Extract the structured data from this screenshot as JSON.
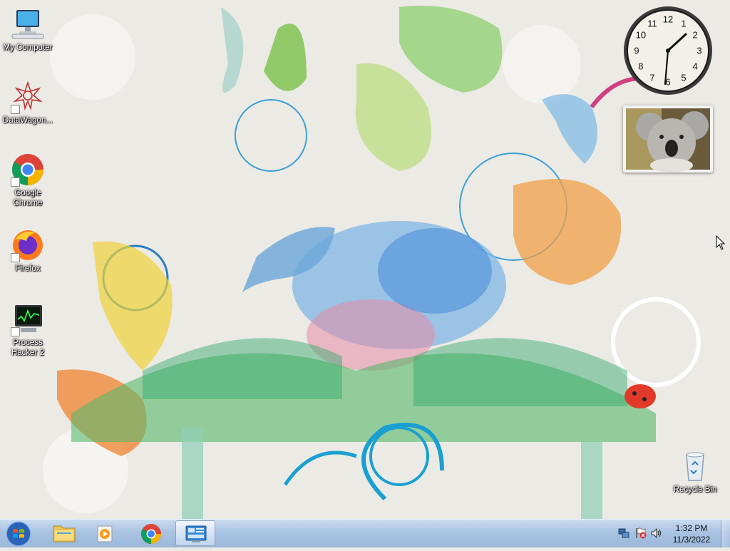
{
  "desktop": {
    "icons": [
      {
        "label": "My Computer",
        "icon": "computer-icon"
      },
      {
        "label": "DataWagon...",
        "icon": "datawagon-icon"
      },
      {
        "label": "Google Chrome",
        "icon": "chrome-icon"
      },
      {
        "label": "Firefox",
        "icon": "firefox-icon"
      },
      {
        "label": "Process Hacker 2",
        "icon": "process-hacker-icon"
      },
      {
        "label": "Recycle Bin",
        "icon": "recycle-bin-icon"
      }
    ]
  },
  "gadgets": {
    "clock": {
      "hour_labels": [
        "12",
        "1",
        "2",
        "3",
        "4",
        "5",
        "6",
        "7",
        "8",
        "9",
        "10",
        "11"
      ]
    },
    "photo": {
      "subject": "koala-photo"
    }
  },
  "taskbar": {
    "pinned": [
      {
        "icon": "windows-explorer-icon",
        "active": false
      },
      {
        "icon": "media-player-icon",
        "active": false
      },
      {
        "icon": "chrome-icon",
        "active": false
      },
      {
        "icon": "control-panel-icon",
        "active": true
      }
    ],
    "tray": {
      "time": "1:32 PM",
      "date": "11/3/2022"
    }
  },
  "colors": {
    "taskbar": "#a9c3e2",
    "wallpaper_bg": "#eceae4"
  }
}
